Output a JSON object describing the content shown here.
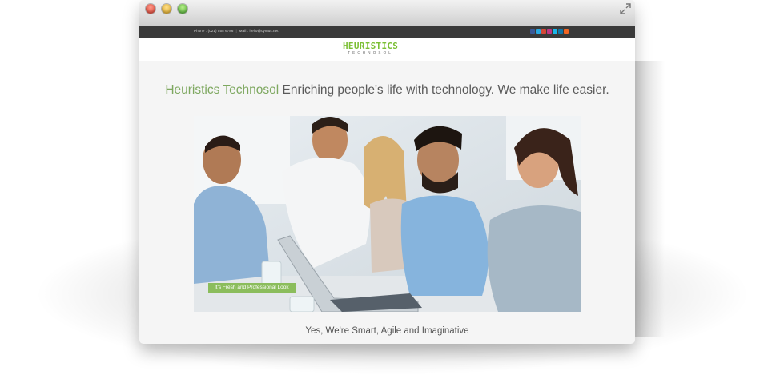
{
  "window": {
    "controls": [
      "close",
      "minimize",
      "zoom"
    ],
    "expand_icon": "expand-arrows-icon"
  },
  "topbar": {
    "phone": "Phone : (021) 555 6786",
    "separator": "|",
    "mail": "Mail : hello@cymus.net",
    "social_icons": [
      {
        "name": "facebook-icon",
        "color": "#3b5998"
      },
      {
        "name": "twitter-icon",
        "color": "#29a9e1"
      },
      {
        "name": "googleplus-icon",
        "color": "#d34836"
      },
      {
        "name": "instagram-icon",
        "color": "#c13584"
      },
      {
        "name": "vimeo-icon",
        "color": "#1ab7ea"
      },
      {
        "name": "linkedin-icon",
        "color": "#0e76a8"
      },
      {
        "name": "rss-icon",
        "color": "#f26522"
      }
    ]
  },
  "logo": {
    "main": "HEURISTICS",
    "sub": "TECHNOSOL",
    "color": "#7bbf34"
  },
  "headline": {
    "brand": "Heuristics Technosol",
    "rest": " Enriching people's life with technology. We make life easier.",
    "brand_color": "#7ea860"
  },
  "hero": {
    "caption": "It's Fresh and Professional Look",
    "caption_color": "#8bbd5c"
  },
  "tagline": "Yes, We're Smart, Agile and Imaginative"
}
